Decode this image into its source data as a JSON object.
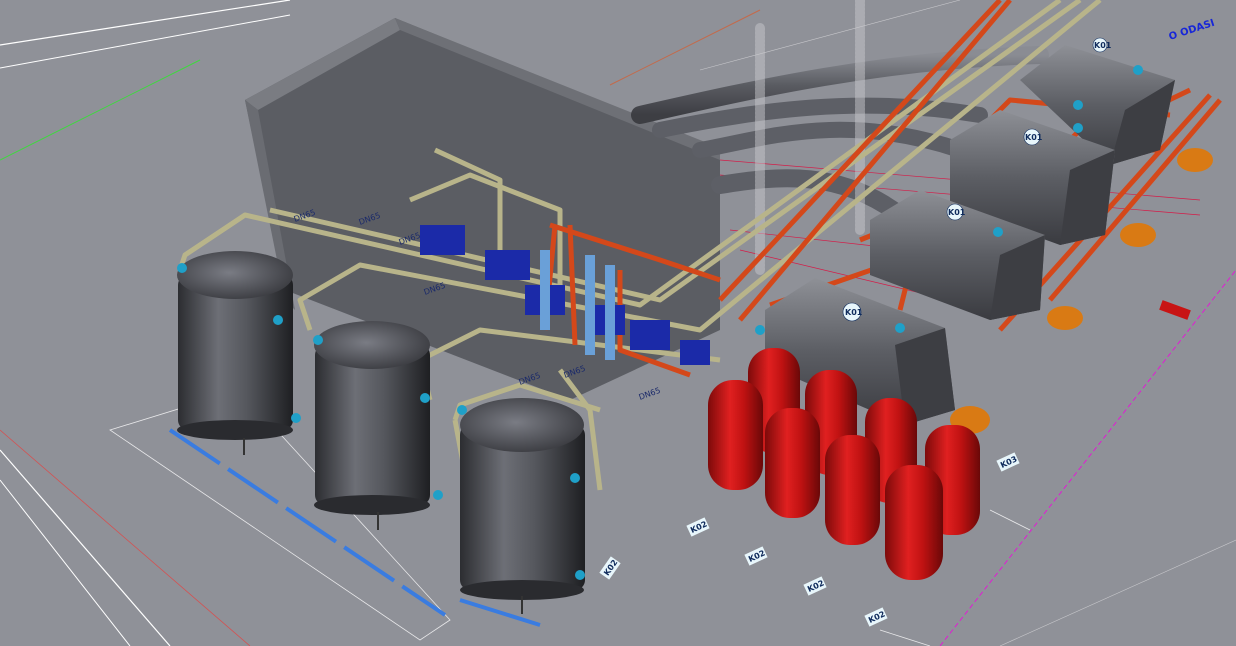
{
  "view": {
    "background": "#8f9198",
    "room_label": "O ODASI",
    "boiler_tag": "K01",
    "pipe_tag": "K02",
    "side_tag": "K03",
    "callout_text": "DN65"
  },
  "colors": {
    "pipe_supply": "#d4481a",
    "pipe_return": "#b8b48a",
    "tank_grey": "#4a4c52",
    "expansion_red": "#c81414",
    "flue": "#6b6e76",
    "wall": "#5f6167",
    "valve": "#1fa0c8",
    "pump": "#1b2aa8",
    "burner": "#d97a14",
    "cad_line": "#d41c48",
    "cad_magenta": "#e01cd4",
    "cad_blue": "#2a4fd6"
  },
  "icons": {
    "boiler": "boiler-icon",
    "tank": "storage-tank-icon",
    "expansion_vessel": "expansion-vessel-icon",
    "pump": "pump-icon",
    "valve": "valve-icon"
  }
}
